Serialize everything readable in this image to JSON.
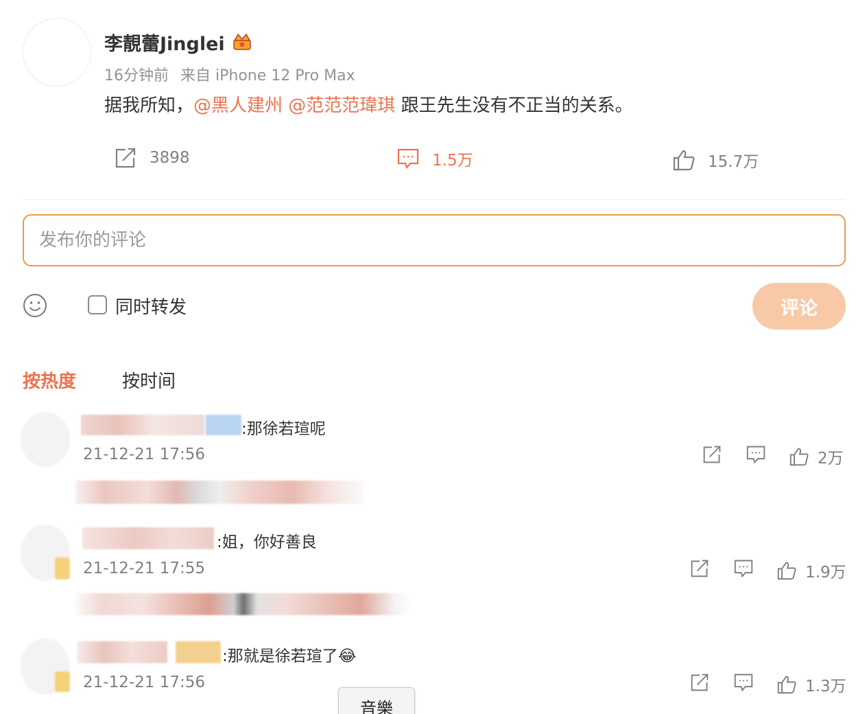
{
  "post": {
    "username": "李靚蕾Jinglei",
    "time": "16分钟前",
    "source": "来自 iPhone 12 Pro Max",
    "text_prefix": "据我所知，",
    "mention_1": "@黑人建州",
    "mention_2": "@范范范瑋琪",
    "text_suffix": " 跟王先生没有不正当的关系。",
    "repost_count": "3898",
    "comment_count": "1.5万",
    "like_count": "15.7万"
  },
  "composer": {
    "placeholder": "发布你的评论",
    "also_repost_label": "同时转发",
    "submit_label": "评论"
  },
  "sort_tabs": {
    "hot": "按热度",
    "time": "按时间"
  },
  "comments": [
    {
      "text": ":那徐若瑄呢",
      "time": "21-12-21 17:56",
      "likes": "2万"
    },
    {
      "text": ":姐，你好善良",
      "time": "21-12-21 17:55",
      "likes": "1.9万"
    },
    {
      "text": ":那就是徐若瑄了😂",
      "time": "21-12-21 17:56",
      "likes": "1.3万"
    }
  ],
  "popup": {
    "label": "音樂"
  },
  "colors": {
    "accent": "#eb7350",
    "composer_border": "#eb9a50",
    "submit_bg": "#f8c9a6",
    "muted": "#808080"
  }
}
